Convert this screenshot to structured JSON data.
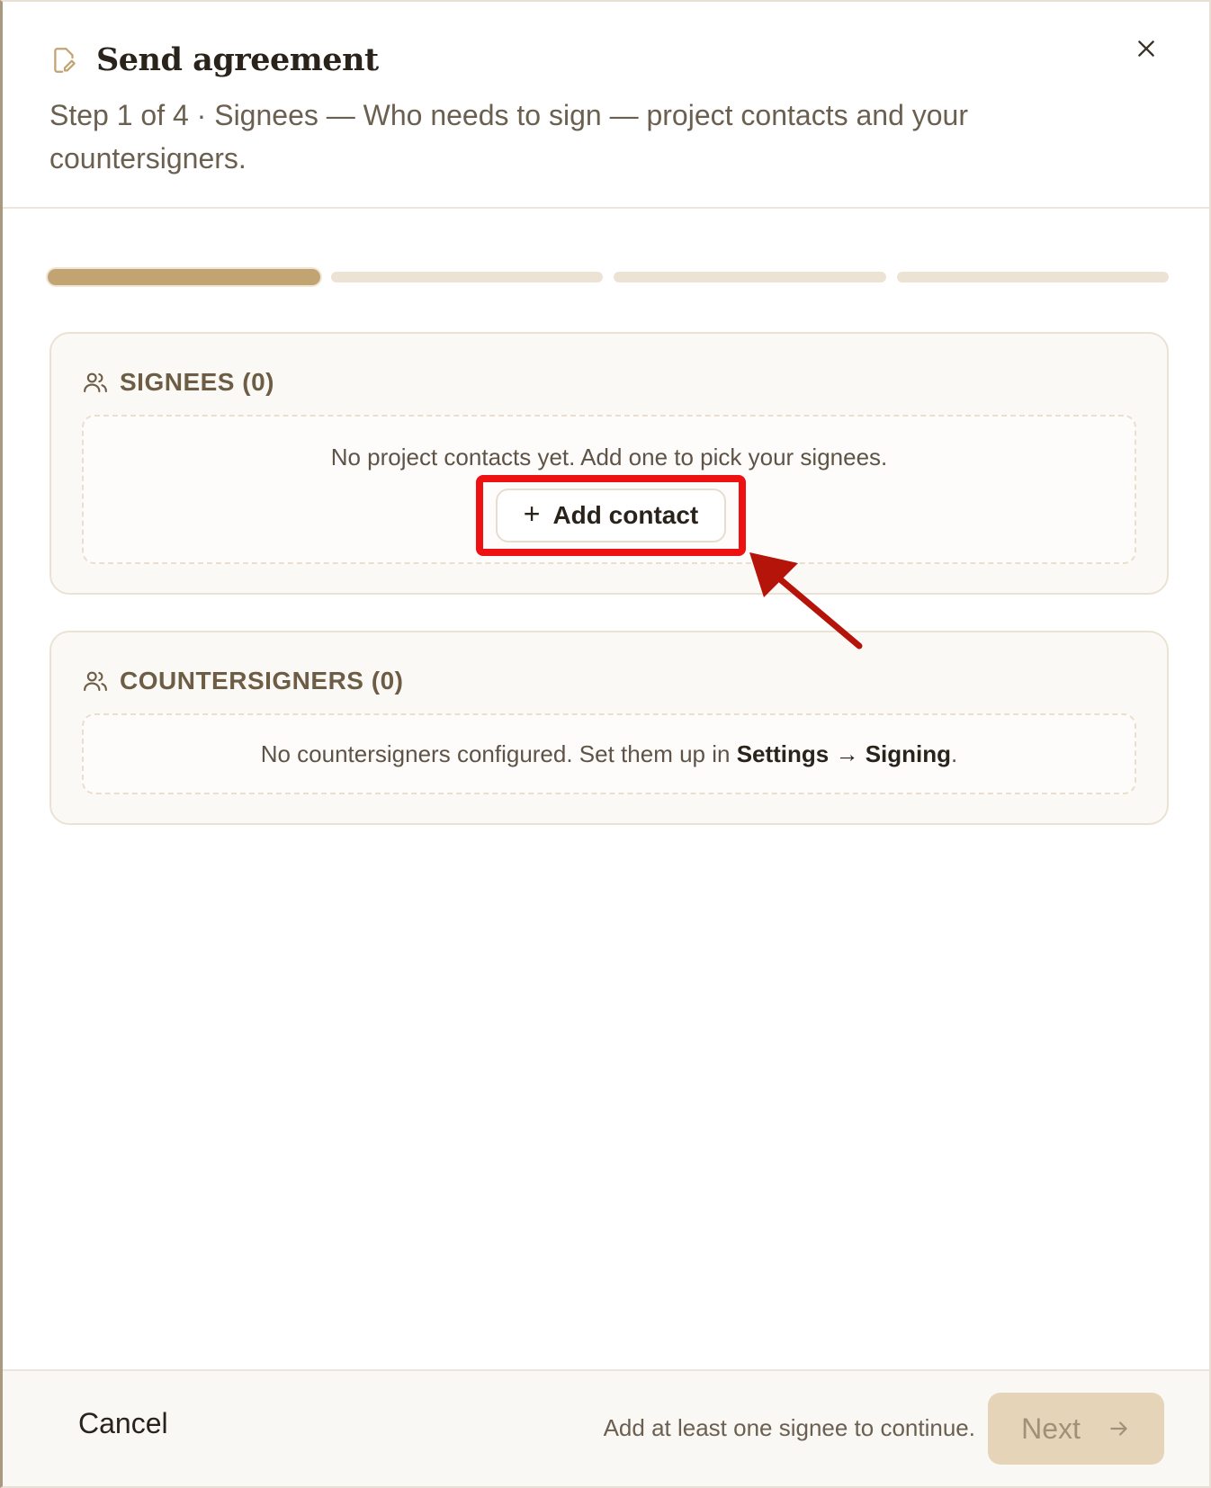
{
  "dialog": {
    "title": "Send agreement",
    "subtitle": "Step 1 of 4 · Signees — Who needs to sign — project contacts and your countersigners.",
    "icons": {
      "title": "document-edit-icon",
      "close": "close-icon"
    },
    "colors": {
      "accent": "#c2a472",
      "highlight": "#ee1111",
      "arrow": "#b5140b"
    }
  },
  "progress": {
    "total_steps": 4,
    "current_step": 1
  },
  "signees": {
    "heading": "SIGNEES (0)",
    "icon": "people-icon",
    "empty_text": "No project contacts yet. Add one to pick your signees.",
    "add_button": {
      "icon": "+",
      "label": "Add contact"
    }
  },
  "countersigners": {
    "heading": "COUNTERSIGNERS (0)",
    "icon": "people-icon",
    "empty_prefix": "No countersigners configured. Set them up in ",
    "empty_link": "Settings → Signing",
    "empty_suffix": "."
  },
  "footer": {
    "cancel_label": "Cancel",
    "hint": "Add at least one signee to continue.",
    "next_label": "Next",
    "next_icon": "arrow-right-icon"
  }
}
